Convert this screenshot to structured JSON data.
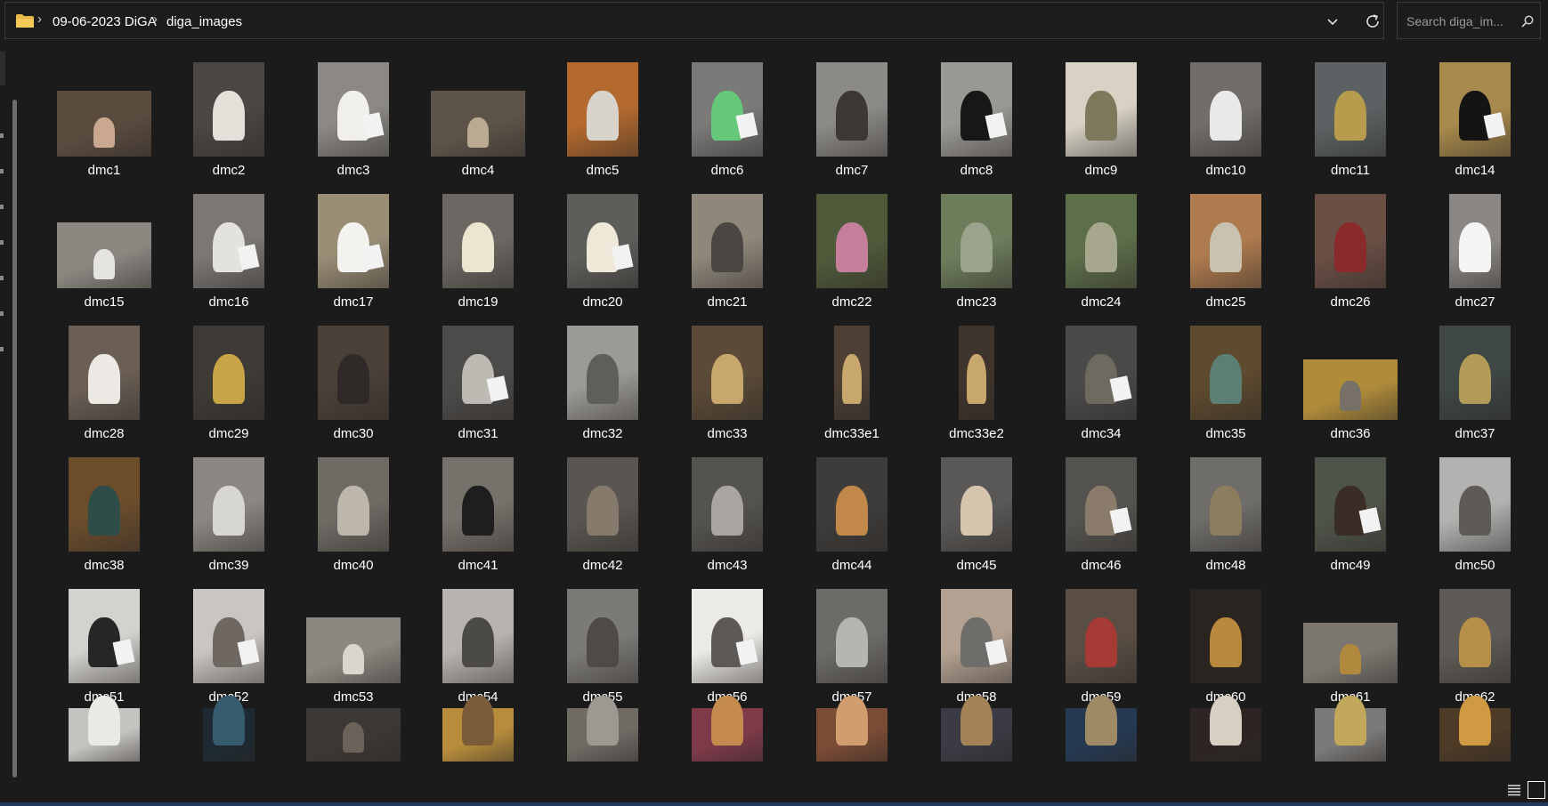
{
  "breadcrumb": {
    "items": [
      "09-06-2023 DiGA",
      "diga_images"
    ]
  },
  "search": {
    "placeholder": "Search diga_im..."
  },
  "files": [
    {
      "name": "dmc1",
      "thumb": "land2",
      "bg": "#5a4b3f",
      "fg": "#c9a88f",
      "tag": false
    },
    {
      "name": "dmc2",
      "thumb": "port",
      "bg": "#4a4643",
      "fg": "#e3e0da",
      "tag": false
    },
    {
      "name": "dmc3",
      "thumb": "port",
      "bg": "#8c8984",
      "fg": "#f0efec",
      "tag": true
    },
    {
      "name": "dmc4",
      "thumb": "land2",
      "bg": "#5d5348",
      "fg": "#b9aa91",
      "tag": false
    },
    {
      "name": "dmc5",
      "thumb": "port",
      "bg": "#b46a2e",
      "fg": "#d8d4cc",
      "tag": false
    },
    {
      "name": "dmc6",
      "thumb": "port",
      "bg": "#7a7a78",
      "fg": "#66c879",
      "tag": true
    },
    {
      "name": "dmc7",
      "thumb": "port",
      "bg": "#8c8a87",
      "fg": "#3b3836",
      "tag": false
    },
    {
      "name": "dmc8",
      "thumb": "port",
      "bg": "#9a9892",
      "fg": "#171717",
      "tag": true
    },
    {
      "name": "dmc9",
      "thumb": "port",
      "bg": "#d8d2c5",
      "fg": "#7d7a5c",
      "tag": false
    },
    {
      "name": "dmc10",
      "thumb": "port",
      "bg": "#706d69",
      "fg": "#e9e9e9",
      "tag": false
    },
    {
      "name": "dmc11",
      "thumb": "port",
      "bg": "#5c6263",
      "fg": "#b89c4e",
      "tag": false
    },
    {
      "name": "dmc14",
      "thumb": "port",
      "bg": "#a88a4c",
      "fg": "#141414",
      "tag": true
    },
    {
      "name": "dmc15",
      "thumb": "land2",
      "bg": "#8a8680",
      "fg": "#e5e3df",
      "tag": false
    },
    {
      "name": "dmc16",
      "thumb": "port",
      "bg": "#7b7773",
      "fg": "#e4e2dd",
      "tag": true
    },
    {
      "name": "dmc17",
      "thumb": "port",
      "bg": "#9a8d76",
      "fg": "#f3f2ef",
      "tag": true
    },
    {
      "name": "dmc19",
      "thumb": "port",
      "bg": "#6b6762",
      "fg": "#ece5cf",
      "tag": false
    },
    {
      "name": "dmc20",
      "thumb": "port",
      "bg": "#5d5d5a",
      "fg": "#ede8d8",
      "tag": true
    },
    {
      "name": "dmc21",
      "thumb": "port",
      "bg": "#8f877a",
      "fg": "#4a4642",
      "tag": false
    },
    {
      "name": "dmc22",
      "thumb": "port",
      "bg": "#4f5a3a",
      "fg": "#c67f9b",
      "tag": false
    },
    {
      "name": "dmc23",
      "thumb": "port",
      "bg": "#6d7d5c",
      "fg": "#9aa38b",
      "tag": false
    },
    {
      "name": "dmc24",
      "thumb": "port",
      "bg": "#5d6e4a",
      "fg": "#a6a78d",
      "tag": false
    },
    {
      "name": "dmc25",
      "thumb": "port",
      "bg": "#ae7b4e",
      "fg": "#c9c2b1",
      "tag": false
    },
    {
      "name": "dmc26",
      "thumb": "port",
      "bg": "#6a4f45",
      "fg": "#8b2a2a",
      "tag": false
    },
    {
      "name": "dmc27",
      "thumb": "narrow2",
      "bg": "#8a8784",
      "fg": "#f4f4f4",
      "tag": false
    },
    {
      "name": "dmc28",
      "thumb": "port",
      "bg": "#6b5f55",
      "fg": "#ece9e4",
      "tag": false
    },
    {
      "name": "dmc29",
      "thumb": "port",
      "bg": "#3e3a35",
      "fg": "#c9a446",
      "tag": false
    },
    {
      "name": "dmc30",
      "thumb": "port",
      "bg": "#4b4038",
      "fg": "#2f2a27",
      "tag": false
    },
    {
      "name": "dmc31",
      "thumb": "port",
      "bg": "#4d4b49",
      "fg": "#bdb9b3",
      "tag": true
    },
    {
      "name": "dmc32",
      "thumb": "port",
      "bg": "#9c9a97",
      "fg": "#5f5e5b",
      "tag": false
    },
    {
      "name": "dmc33",
      "thumb": "port",
      "bg": "#5b4a37",
      "fg": "#c8a76d",
      "tag": false
    },
    {
      "name": "dmc33e1",
      "thumb": "narrow",
      "bg": "#4d3f33",
      "fg": "#c8a76d",
      "tag": false
    },
    {
      "name": "dmc33e2",
      "thumb": "narrow",
      "bg": "#3f342b",
      "fg": "#c8a76d",
      "tag": false
    },
    {
      "name": "dmc34",
      "thumb": "port",
      "bg": "#4a4a48",
      "fg": "#6e6a60",
      "tag": true
    },
    {
      "name": "dmc35",
      "thumb": "port",
      "bg": "#5e4a2e",
      "fg": "#5c7f74",
      "tag": false
    },
    {
      "name": "dmc36",
      "thumb": "land3",
      "bg": "#b08c3a",
      "fg": "#767067",
      "tag": false
    },
    {
      "name": "dmc37",
      "thumb": "port",
      "bg": "#3e4646",
      "fg": "#b29a57",
      "tag": false
    },
    {
      "name": "dmc38",
      "thumb": "port",
      "bg": "#6b4d2c",
      "fg": "#2f4d48",
      "tag": false
    },
    {
      "name": "dmc39",
      "thumb": "port",
      "bg": "#8b8681",
      "fg": "#d8d6d2",
      "tag": false
    },
    {
      "name": "dmc40",
      "thumb": "port",
      "bg": "#6f6a64",
      "fg": "#bdb6ab",
      "tag": false
    },
    {
      "name": "dmc41",
      "thumb": "port",
      "bg": "#77716b",
      "fg": "#1e1e1e",
      "tag": false
    },
    {
      "name": "dmc42",
      "thumb": "port",
      "bg": "#5a5550",
      "fg": "#857a6c",
      "tag": false
    },
    {
      "name": "dmc43",
      "thumb": "port",
      "bg": "#55534f",
      "fg": "#a9a6a1",
      "tag": false
    },
    {
      "name": "dmc44",
      "thumb": "port",
      "bg": "#3e3c3a",
      "fg": "#c1884a",
      "tag": false
    },
    {
      "name": "dmc45",
      "thumb": "port",
      "bg": "#5a5856",
      "fg": "#d6c4ae",
      "tag": false
    },
    {
      "name": "dmc46",
      "thumb": "port",
      "bg": "#55534f",
      "fg": "#8a7b6b",
      "tag": true
    },
    {
      "name": "dmc48",
      "thumb": "port",
      "bg": "#6f6d6a",
      "fg": "#8c7d5e",
      "tag": false
    },
    {
      "name": "dmc49",
      "thumb": "port",
      "bg": "#4f544a",
      "fg": "#3a2d26",
      "tag": true
    },
    {
      "name": "dmc50",
      "thumb": "port",
      "bg": "#b2b2b0",
      "fg": "#5e5a55",
      "tag": false
    },
    {
      "name": "dmc51",
      "thumb": "port",
      "bg": "#d4d2ce",
      "fg": "#262626",
      "tag": true
    },
    {
      "name": "dmc52",
      "thumb": "port",
      "bg": "#c9c6c1",
      "fg": "#6f6862",
      "tag": true
    },
    {
      "name": "dmc53",
      "thumb": "land2",
      "bg": "#8c8780",
      "fg": "#d9d5cf",
      "tag": false
    },
    {
      "name": "dmc54",
      "thumb": "port",
      "bg": "#b7b4b0",
      "fg": "#4c4a47",
      "tag": false
    },
    {
      "name": "dmc55",
      "thumb": "port",
      "bg": "#7c7a77",
      "fg": "#4d4a47",
      "tag": false
    },
    {
      "name": "dmc56",
      "thumb": "port",
      "bg": "#eceae7",
      "fg": "#5c5956",
      "tag": true
    },
    {
      "name": "dmc57",
      "thumb": "port",
      "bg": "#6d6b68",
      "fg": "#b7b5b1",
      "tag": false
    },
    {
      "name": "dmc58",
      "thumb": "port",
      "bg": "#b3a192",
      "fg": "#6f6d6a",
      "tag": true
    },
    {
      "name": "dmc59",
      "thumb": "port",
      "bg": "#5a4e44",
      "fg": "#a63a34",
      "tag": false
    },
    {
      "name": "dmc60",
      "thumb": "port",
      "bg": "#2a2420",
      "fg": "#b8883c",
      "tag": false
    },
    {
      "name": "dmc61",
      "thumb": "land3",
      "bg": "#7b7770",
      "fg": "#b0893f",
      "tag": false
    },
    {
      "name": "dmc62",
      "thumb": "port",
      "bg": "#5e5a55",
      "fg": "#b78f48",
      "tag": false
    },
    {
      "name": "",
      "thumb": "port",
      "bg": "#c5c3c0",
      "fg": "#ebe9e6",
      "tag": false,
      "cut": true
    },
    {
      "name": "",
      "thumb": "narrow2",
      "bg": "#1d2a33",
      "fg": "#365a6e",
      "tag": false,
      "cut": true
    },
    {
      "name": "",
      "thumb": "land",
      "bg": "#3c3835",
      "fg": "#6b625a",
      "tag": false,
      "cut": true
    },
    {
      "name": "",
      "thumb": "port",
      "bg": "#b78d3c",
      "fg": "#7a5c3a",
      "tag": false,
      "cut": true
    },
    {
      "name": "",
      "thumb": "port",
      "bg": "#6f6a64",
      "fg": "#9d9990",
      "tag": false,
      "cut": true
    },
    {
      "name": "",
      "thumb": "port",
      "bg": "#7e3a49",
      "fg": "#c58b4e",
      "tag": false,
      "cut": true
    },
    {
      "name": "",
      "thumb": "port",
      "bg": "#7a4b35",
      "fg": "#d19c6e",
      "tag": false,
      "cut": true
    },
    {
      "name": "",
      "thumb": "port",
      "bg": "#3a3b44",
      "fg": "#a48457",
      "tag": false,
      "cut": true
    },
    {
      "name": "",
      "thumb": "port",
      "bg": "#253953",
      "fg": "#9f8a66",
      "tag": false,
      "cut": true
    },
    {
      "name": "",
      "thumb": "port",
      "bg": "#2c2523",
      "fg": "#d8cfc3",
      "tag": false,
      "cut": true
    },
    {
      "name": "",
      "thumb": "port",
      "bg": "#7c7a78",
      "fg": "#c1a85a",
      "tag": false,
      "cut": true
    },
    {
      "name": "",
      "thumb": "port",
      "bg": "#4d3a27",
      "fg": "#d09a43",
      "tag": false,
      "cut": true
    }
  ]
}
